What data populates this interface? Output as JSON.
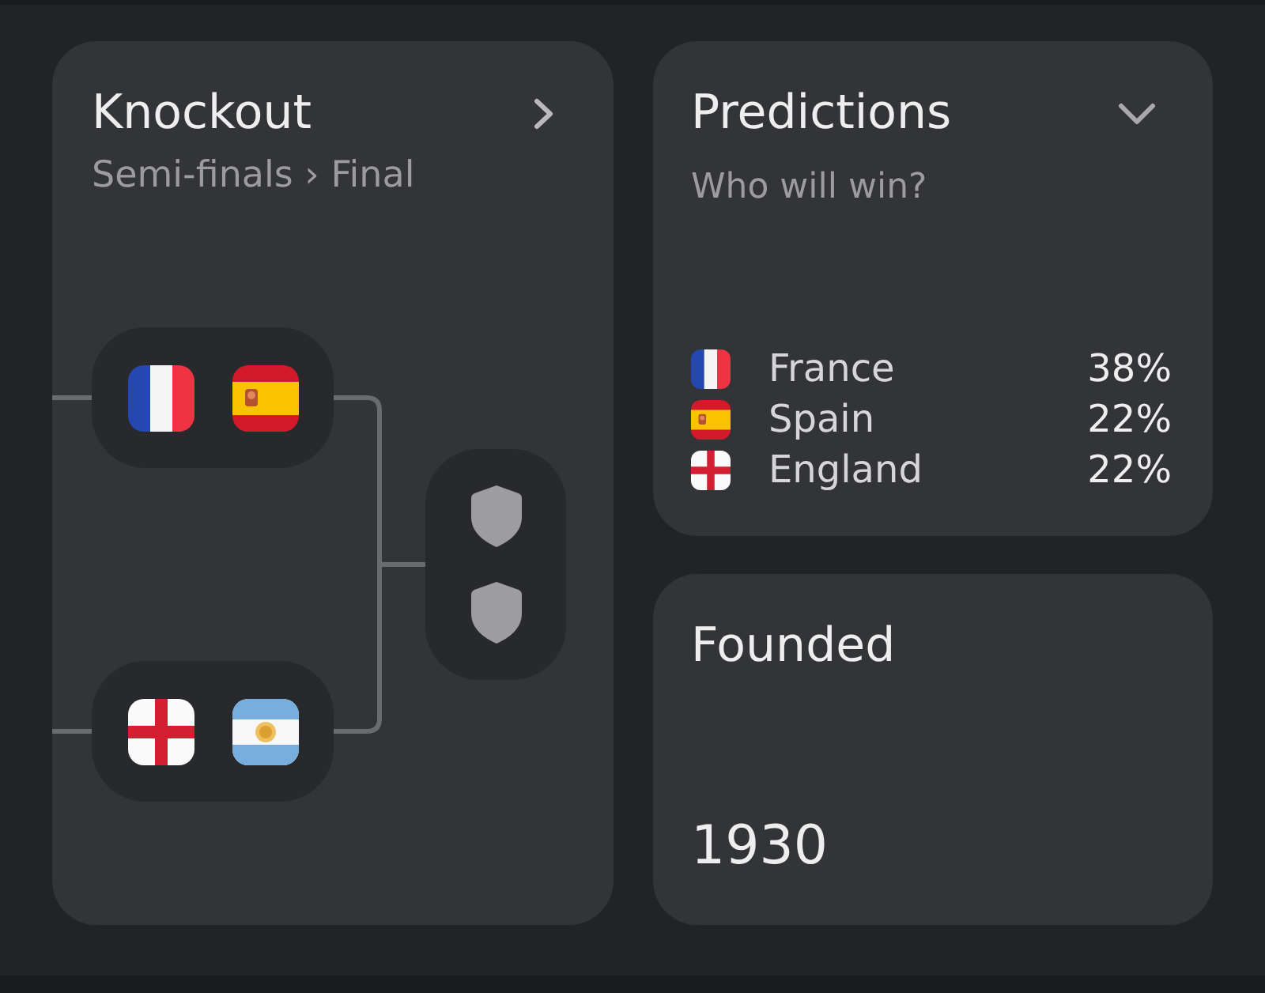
{
  "knockout": {
    "title": "Knockout",
    "subtitle": "Semi-finals › Final",
    "semi_finals": [
      {
        "teams": [
          {
            "kind": "france"
          },
          {
            "kind": "spain"
          }
        ]
      },
      {
        "teams": [
          {
            "kind": "england"
          },
          {
            "kind": "argentina"
          }
        ]
      }
    ],
    "final": {
      "teams": [
        {
          "kind": "unknown"
        },
        {
          "kind": "unknown"
        }
      ]
    }
  },
  "predictions": {
    "title": "Predictions",
    "subtitle": "Who will win?",
    "rows": [
      {
        "kind": "france",
        "team": "France",
        "share": "38%"
      },
      {
        "kind": "spain",
        "team": "Spain",
        "share": "22%"
      },
      {
        "kind": "england",
        "team": "England",
        "share": "22%"
      }
    ]
  },
  "founded": {
    "title": "Founded",
    "value": "1930"
  }
}
